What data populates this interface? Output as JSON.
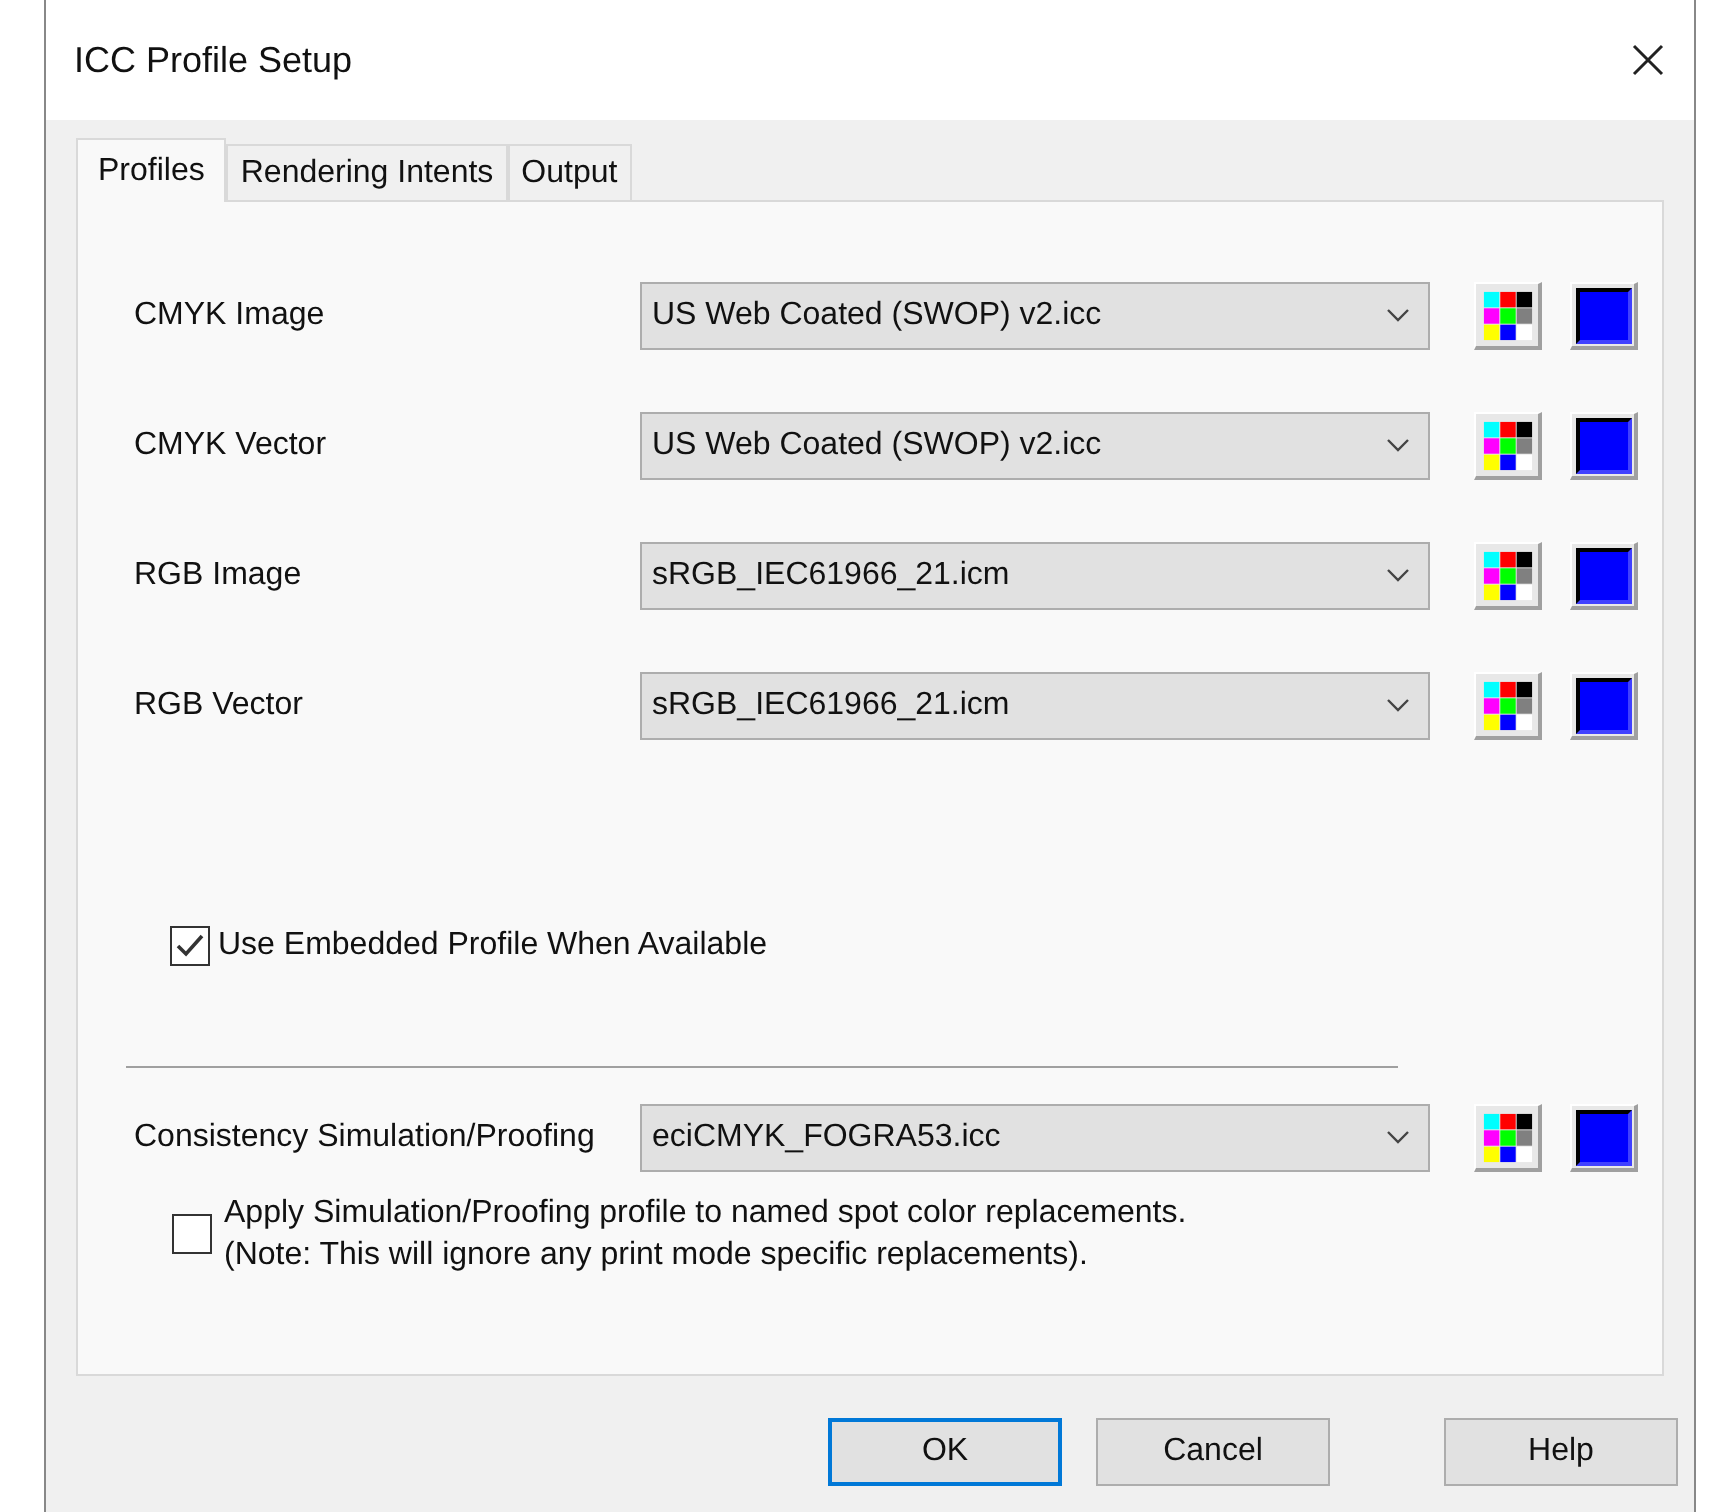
{
  "window": {
    "title": "ICC Profile Setup"
  },
  "tabs": [
    {
      "label": "Profiles",
      "selected": true
    },
    {
      "label": "Rendering Intents",
      "selected": false
    },
    {
      "label": "Output",
      "selected": false
    }
  ],
  "profiles": [
    {
      "label": "CMYK Image",
      "value": "US Web Coated (SWOP) v2.icc"
    },
    {
      "label": "CMYK Vector",
      "value": "US Web Coated (SWOP) v2.icc"
    },
    {
      "label": "RGB Image",
      "value": "sRGB_IEC61966_21.icm"
    },
    {
      "label": "RGB Vector",
      "value": "sRGB_IEC61966_21.icm"
    }
  ],
  "embedded_profile": {
    "label": "Use Embedded Profile When Available",
    "checked": true
  },
  "proofing": {
    "label": "Consistency Simulation/Proofing",
    "value": "eciCMYK_FOGRA53.icc"
  },
  "spot_color": {
    "lines": [
      "Apply Simulation/Proofing profile to named spot color replacements.",
      "(Note: This will ignore any print mode specific replacements)."
    ],
    "checked": false
  },
  "buttons": [
    {
      "label": "OK",
      "default": true
    },
    {
      "label": "Cancel",
      "default": false
    },
    {
      "label": "Help",
      "default": false
    }
  ]
}
